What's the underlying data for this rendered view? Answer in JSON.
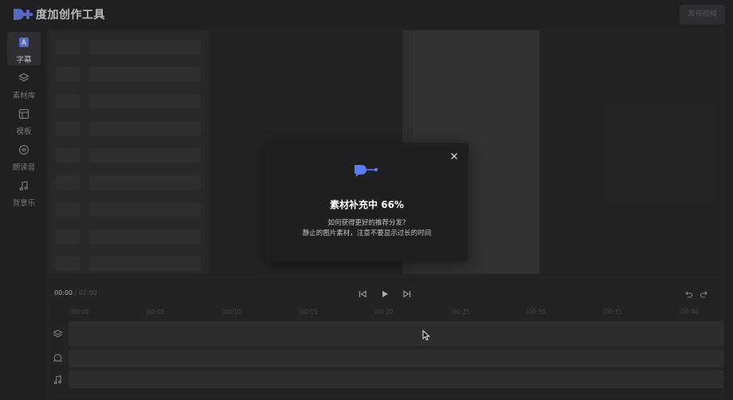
{
  "header": {
    "app_title": "度加创作工具",
    "publish_label": "发布视频"
  },
  "sidebar": {
    "items": [
      {
        "label": "字幕",
        "icon": "subtitle-icon",
        "active": true
      },
      {
        "label": "素材库",
        "icon": "layers-icon",
        "active": false
      },
      {
        "label": "模板",
        "icon": "template-icon",
        "active": false
      },
      {
        "label": "朗读音",
        "icon": "voice-icon",
        "active": false
      },
      {
        "label": "背景乐",
        "icon": "music-note-icon",
        "active": false
      }
    ]
  },
  "timeline": {
    "current_time": "00:00",
    "separator": " / ",
    "total_time": "02:00",
    "ruler": [
      "00:00",
      "00:05",
      "00:10",
      "00:15",
      "00:20",
      "00:25",
      "00:30",
      "00:35",
      "00:40"
    ]
  },
  "modal": {
    "title": "素材补充中 66%",
    "progress_percent": 66,
    "line1": "如何获得更好的推荐分发?",
    "line2": "静止的图片素材，注意不要显示过长的时间"
  },
  "colors": {
    "accent": "#5b7cf6",
    "background": "#2a2a2d",
    "modal_bg": "#1f1f22"
  }
}
